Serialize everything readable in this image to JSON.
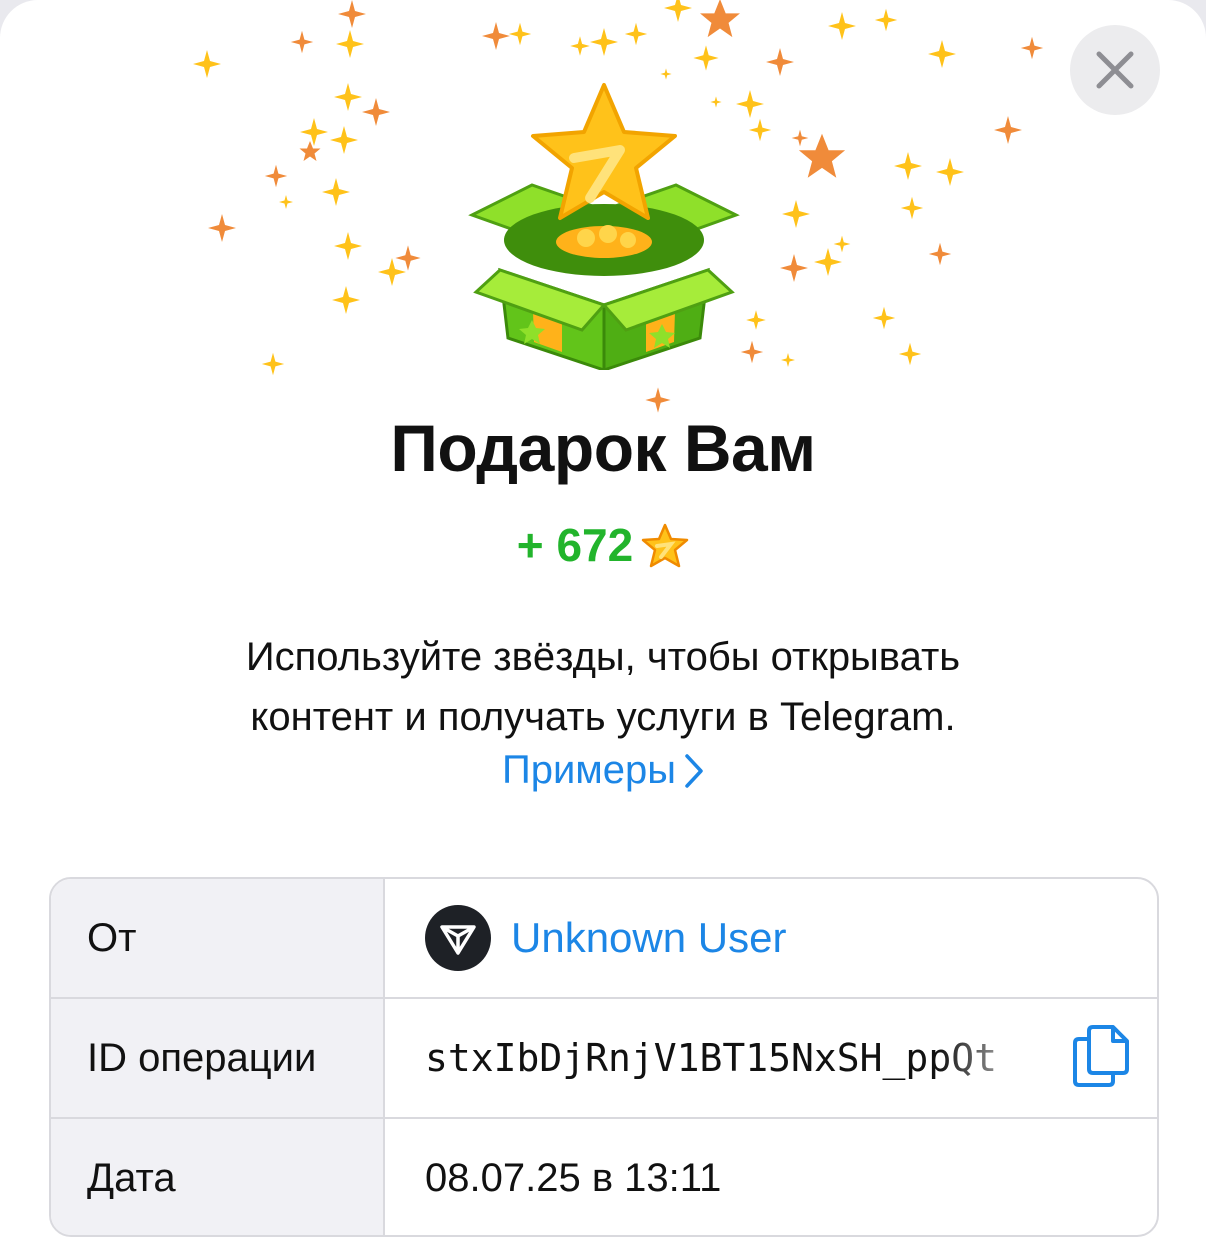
{
  "colors": {
    "accent": "#1c86e6",
    "amount_green": "#22b42c",
    "star_yellow": "#ffc21a",
    "star_orange": "#f08b3a",
    "box_green": "#7ed321"
  },
  "header": {
    "close_icon": "close-icon",
    "gift_icon": "gift-box-star-icon"
  },
  "gift": {
    "title": "Подарок Вам",
    "amount": "+ 672",
    "amount_icon": "telegram-star-icon"
  },
  "description": {
    "line1": "Используйте звёзды, чтобы открывать",
    "line2": "контент и получать услуги в Telegram.",
    "link_label": "Примеры"
  },
  "details": {
    "rows": [
      {
        "label": "От",
        "value": "Unknown User",
        "icon": "anonymous-user-avatar-icon"
      },
      {
        "label": "ID операции",
        "value": "stxIbDjRnjV1BT15NxSH_ppQt",
        "icon": "copy-icon"
      },
      {
        "label": "Дата",
        "value": "08.07.25 в 13:11"
      }
    ]
  }
}
